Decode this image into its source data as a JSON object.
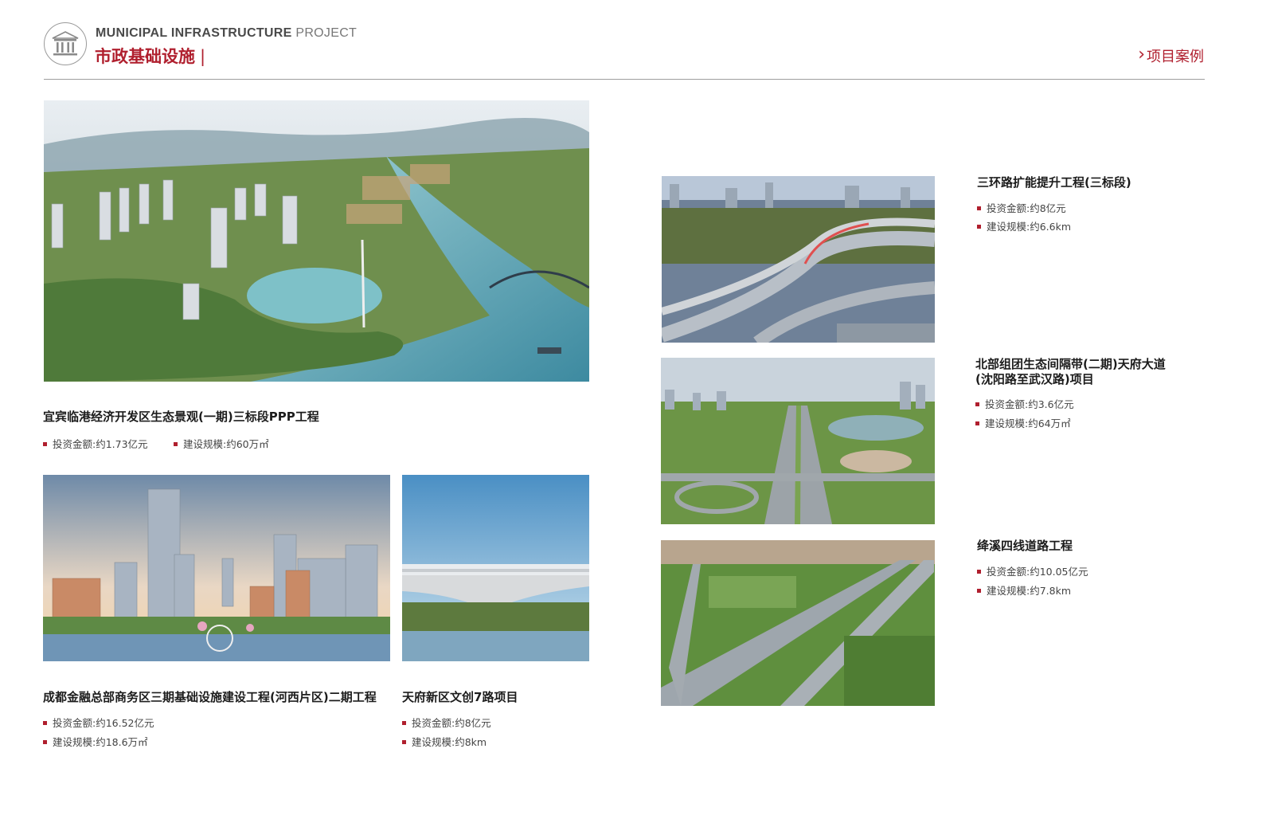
{
  "header": {
    "title_en_bold": "MUNICIPAL INFRASTRUCTURE",
    "title_en_light": "PROJECT",
    "title_cn": "市政基础设施",
    "title_cn_bar": "|",
    "nav_chevron": "›",
    "nav_label": "项目案例",
    "logo_icon": "government-building-icon"
  },
  "accent_color": "#b01f2e",
  "projects": [
    {
      "title": "宜宾临港经济开发区生态景观(一期)三标段PPP工程",
      "investment": "投资金额:约1.73亿元",
      "scale": "建设规模:约60万㎡",
      "image": "port-district-aerial-image"
    },
    {
      "title": "成都金融总部商务区三期基础设施建设工程(河西片区)二期工程",
      "investment": "投资金额:约16.52亿元",
      "scale": "建设规模:约18.6万㎡",
      "image": "financial-district-skyline-image"
    },
    {
      "title": "天府新区文创7路项目",
      "investment": "投资金额:约8亿元",
      "scale": "建设规模:约8km",
      "image": "arch-bridge-image"
    },
    {
      "title": "三环路扩能提升工程(三标段)",
      "investment": "投资金额:约8亿元",
      "scale": "建设规模:约6.6km",
      "image": "ring-road-interchange-image"
    },
    {
      "title_line1": "北部组团生态间隔带(二期)天府大道",
      "title_line2": "(沈阳路至武汉路)项目",
      "investment": "投资金额:约3.6亿元",
      "scale": "建设规模:约64万㎡",
      "image": "boulevard-aerial-image"
    },
    {
      "title": "绛溪四线道路工程",
      "investment": "投资金额:约10.05亿元",
      "scale": "建设规模:约7.8km",
      "image": "highway-countryside-image"
    }
  ]
}
